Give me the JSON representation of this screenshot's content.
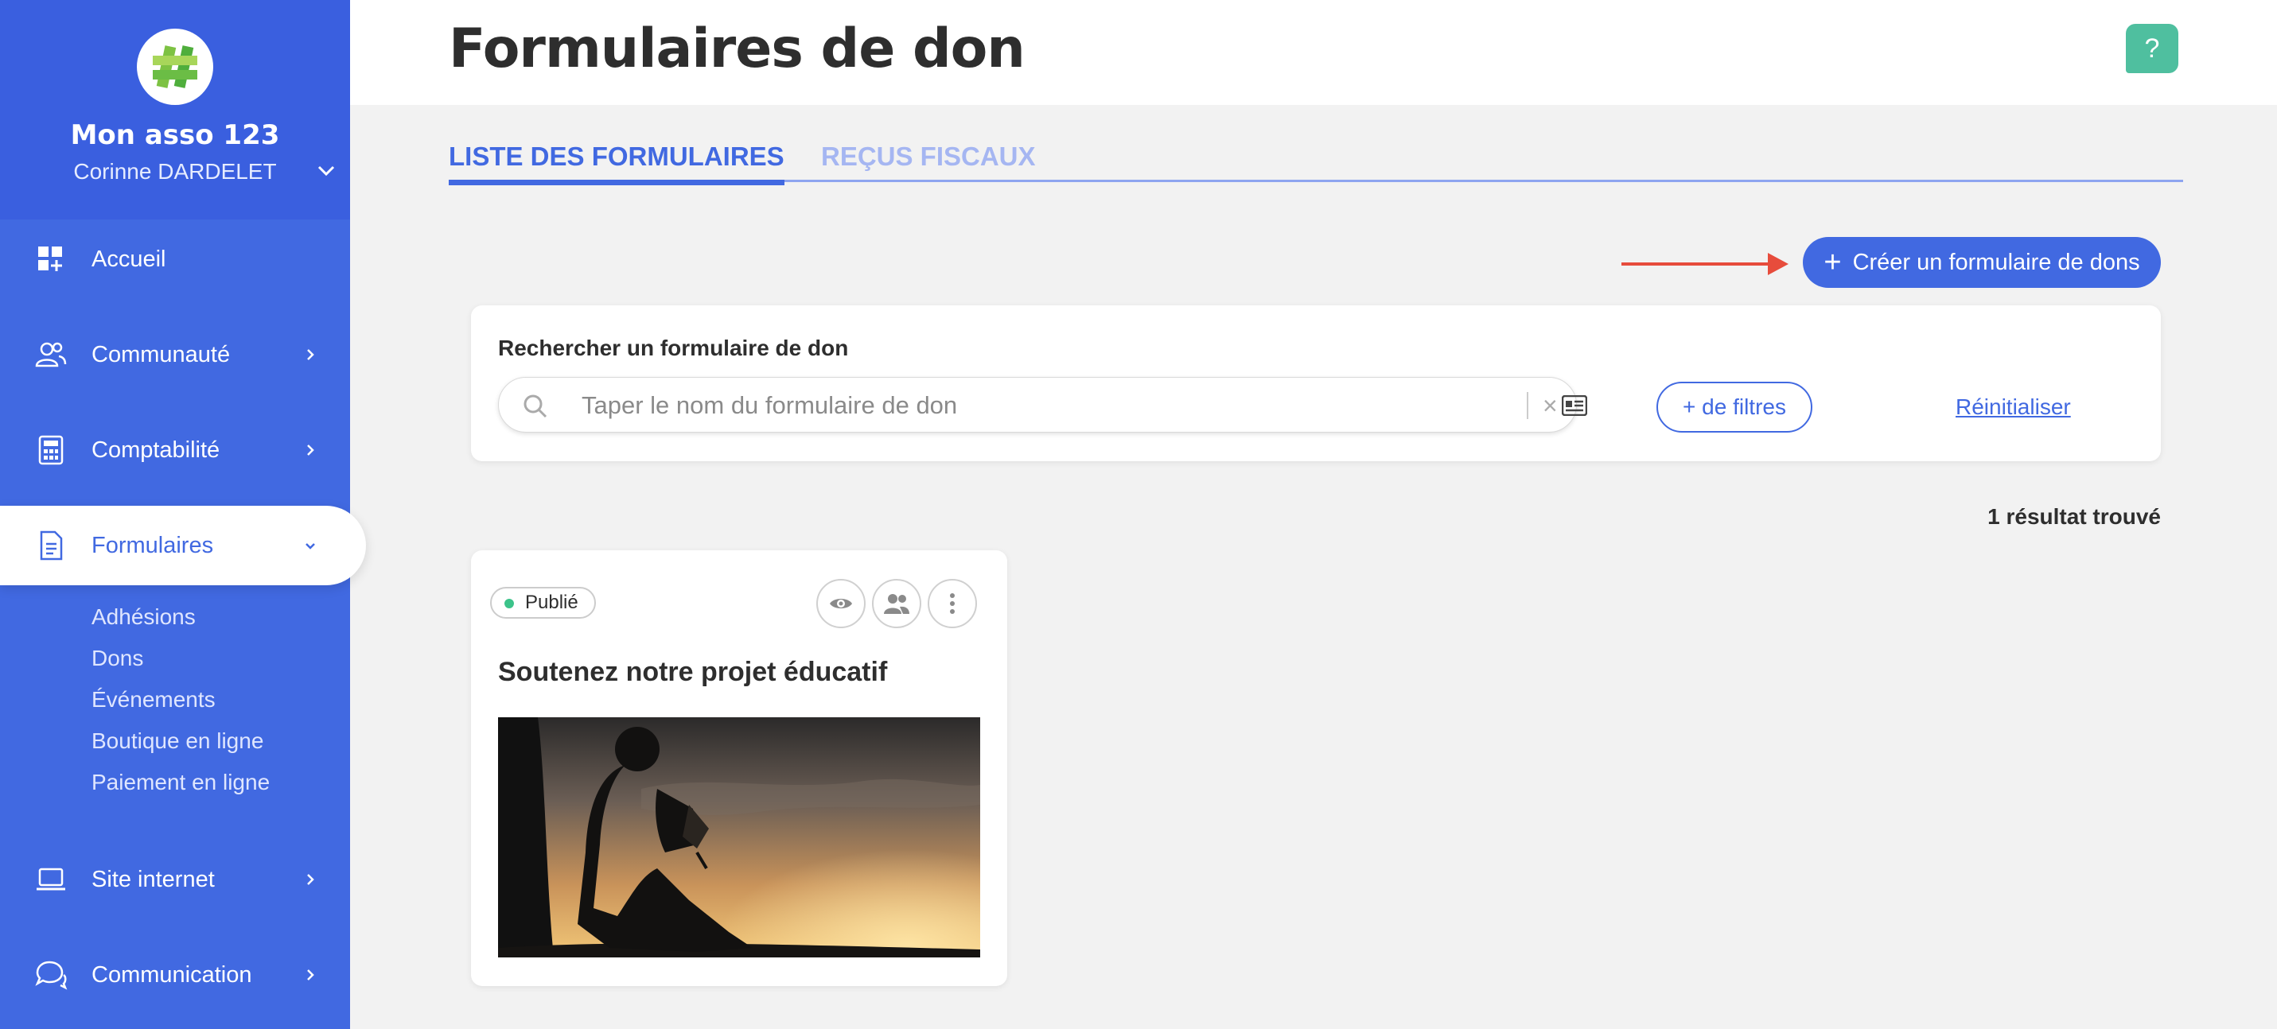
{
  "sidebar": {
    "org_name": "Mon asso 123",
    "user_name": "Corinne DARDELET",
    "items": [
      {
        "label": "Accueil",
        "icon": "dashboard-icon"
      },
      {
        "label": "Communauté",
        "icon": "users-icon"
      },
      {
        "label": "Comptabilité",
        "icon": "calculator-icon"
      },
      {
        "label": "Formulaires",
        "icon": "document-icon"
      },
      {
        "label": "Site internet",
        "icon": "laptop-icon"
      },
      {
        "label": "Communication",
        "icon": "chat-icon"
      }
    ],
    "sub_items": [
      "Adhésions",
      "Dons",
      "Événements",
      "Boutique en ligne",
      "Paiement en ligne"
    ]
  },
  "header": {
    "title": "Formulaires de don",
    "help_label": "?"
  },
  "tabs": [
    {
      "label": "LISTE DES FORMULAIRES",
      "active": true
    },
    {
      "label": "REÇUS FISCAUX",
      "active": false
    }
  ],
  "toolbar": {
    "create_label": "Créer un formulaire de dons",
    "create_plus": "+"
  },
  "search": {
    "label": "Rechercher un formulaire de don",
    "placeholder": "Taper le nom du formulaire de don",
    "clear_symbol": "×",
    "filters_label": "+ de filtres",
    "reset_label": "Réinitialiser"
  },
  "results": {
    "count_text": "1 résultat trouvé"
  },
  "form_card": {
    "status": "Publié",
    "title": "Soutenez notre projet éducatif"
  },
  "colors": {
    "primary": "#4169e1",
    "sidebar_header": "#3a5fdf",
    "success": "#3cc38a",
    "help": "#4fbf9f",
    "arrow": "#e74c3c"
  }
}
